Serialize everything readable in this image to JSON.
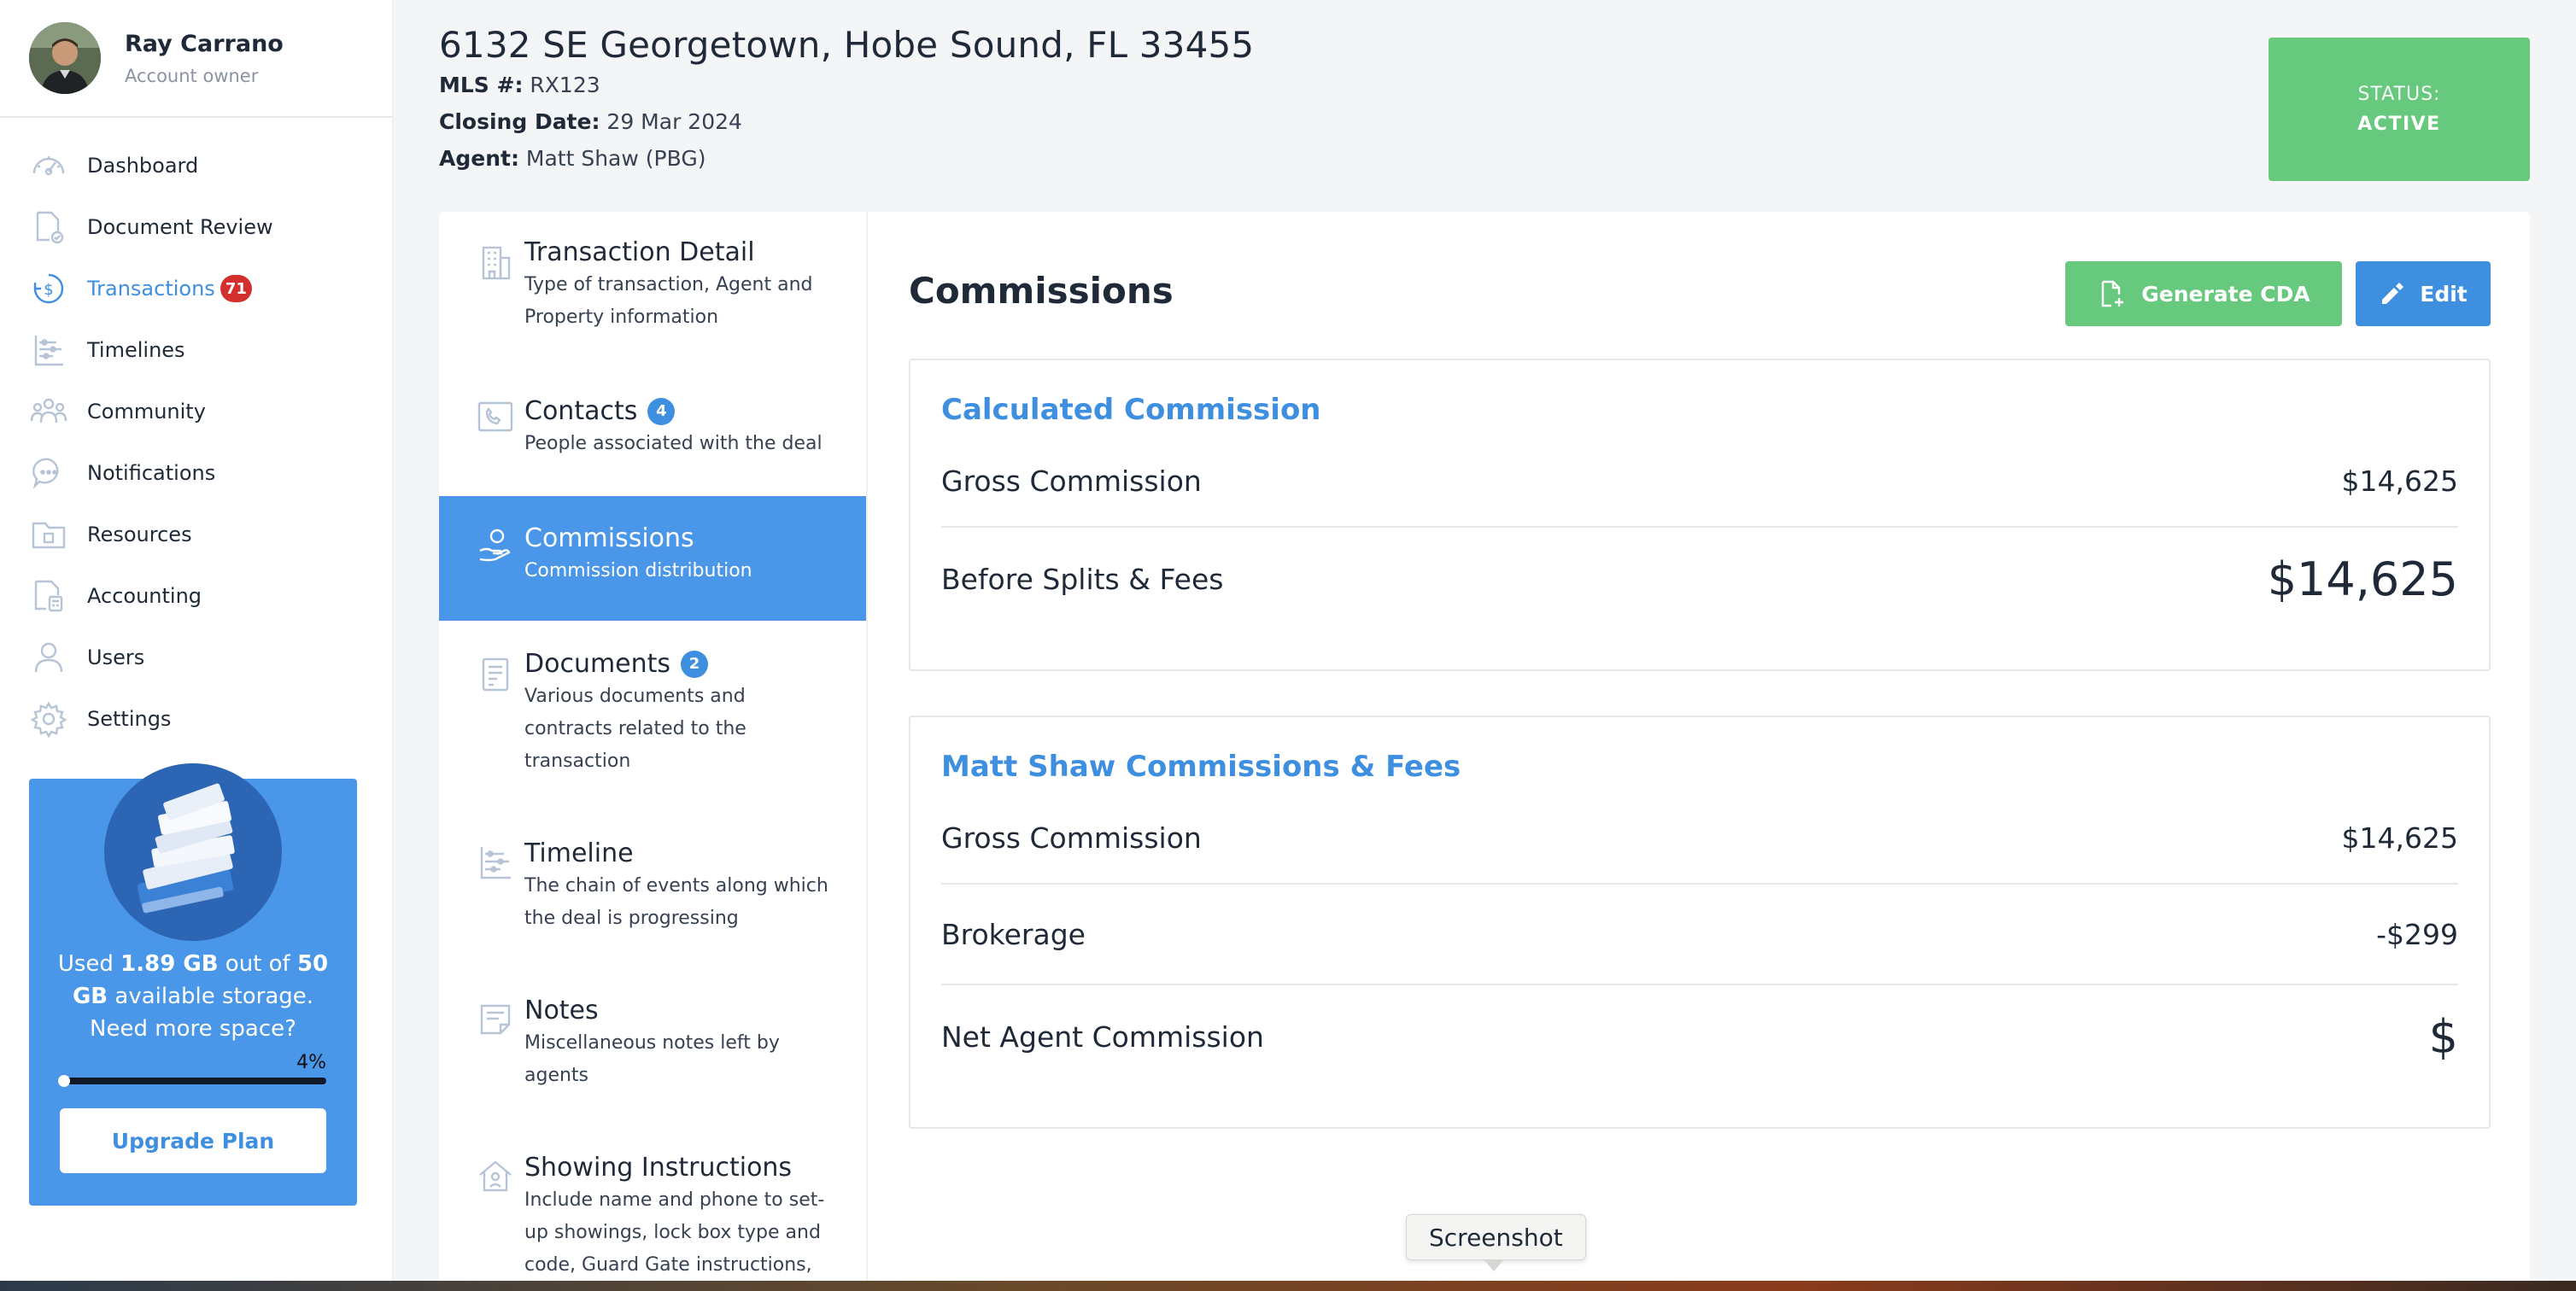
{
  "profile": {
    "name": "Ray Carrano",
    "role": "Account owner"
  },
  "nav": {
    "items": [
      {
        "label": "Dashboard",
        "icon": "dashboard-icon"
      },
      {
        "label": "Document Review",
        "icon": "document-check-icon"
      },
      {
        "label": "Transactions",
        "icon": "dollar-circle-icon",
        "badge": "71",
        "active": true
      },
      {
        "label": "Timelines",
        "icon": "timeline-icon"
      },
      {
        "label": "Community",
        "icon": "community-icon"
      },
      {
        "label": "Notifications",
        "icon": "chat-bubble-icon"
      },
      {
        "label": "Resources",
        "icon": "folder-icon"
      },
      {
        "label": "Accounting",
        "icon": "calculator-doc-icon"
      },
      {
        "label": "Users",
        "icon": "user-icon"
      },
      {
        "label": "Settings",
        "icon": "gear-icon"
      }
    ]
  },
  "storage": {
    "used_prefix": "Used ",
    "used": "1.89 GB",
    "mid": " out of ",
    "total": "50 GB",
    "suffix": " available storage. Need more space?",
    "percent_label": "4%",
    "percent": 0.04,
    "upgrade_label": "Upgrade Plan"
  },
  "header": {
    "address": "6132 SE Georgetown, Hobe Sound, FL 33455",
    "mls_label": "MLS #:",
    "mls_value": "RX123",
    "closing_label": "Closing Date:",
    "closing_value": "29 Mar 2024",
    "agent_label": "Agent:",
    "agent_value": "Matt Shaw (PBG)"
  },
  "status": {
    "label": "STATUS:",
    "value": "ACTIVE"
  },
  "sections": [
    {
      "title": "Transaction Detail",
      "desc": "Type of transaction, Agent and Property information",
      "icon": "building-icon"
    },
    {
      "title": "Contacts",
      "badge": "4",
      "desc": "People associated with the deal",
      "icon": "phone-card-icon"
    },
    {
      "title": "Commissions",
      "desc": "Commission distribution",
      "icon": "hand-coin-icon",
      "active": true
    },
    {
      "title": "Documents",
      "badge": "2",
      "desc": "Various documents and contracts related to the transaction",
      "icon": "document-icon"
    },
    {
      "title": "Timeline",
      "desc": "The chain of events along which the deal is progressing",
      "icon": "timeline-icon"
    },
    {
      "title": "Notes",
      "desc": "Miscellaneous notes left by agents",
      "icon": "note-icon"
    },
    {
      "title": "Showing Instructions",
      "desc": "Include name and phone to set-up showings, lock box type and code, Guard Gate instructions,",
      "icon": "house-icon"
    }
  ],
  "content": {
    "title": "Commissions",
    "generate_label": "Generate CDA",
    "edit_label": "Edit"
  },
  "calculated": {
    "title": "Calculated Commission",
    "rows": [
      {
        "label": "Gross Commission",
        "value": "$14,625"
      },
      {
        "label": "Before Splits & Fees",
        "value": "$14,625"
      }
    ]
  },
  "agent_fees": {
    "title": "Matt Shaw Commissions & Fees",
    "rows": [
      {
        "label": "Gross Commission",
        "value": "$14,625"
      },
      {
        "label": "Brokerage",
        "value": "-$299"
      },
      {
        "label": "Net Agent Commission",
        "value": "$"
      }
    ]
  },
  "tooltip": "Screenshot",
  "colors": {
    "accent": "#3f8fe0",
    "success": "#67c97d",
    "badge_red": "#d32f2f"
  }
}
